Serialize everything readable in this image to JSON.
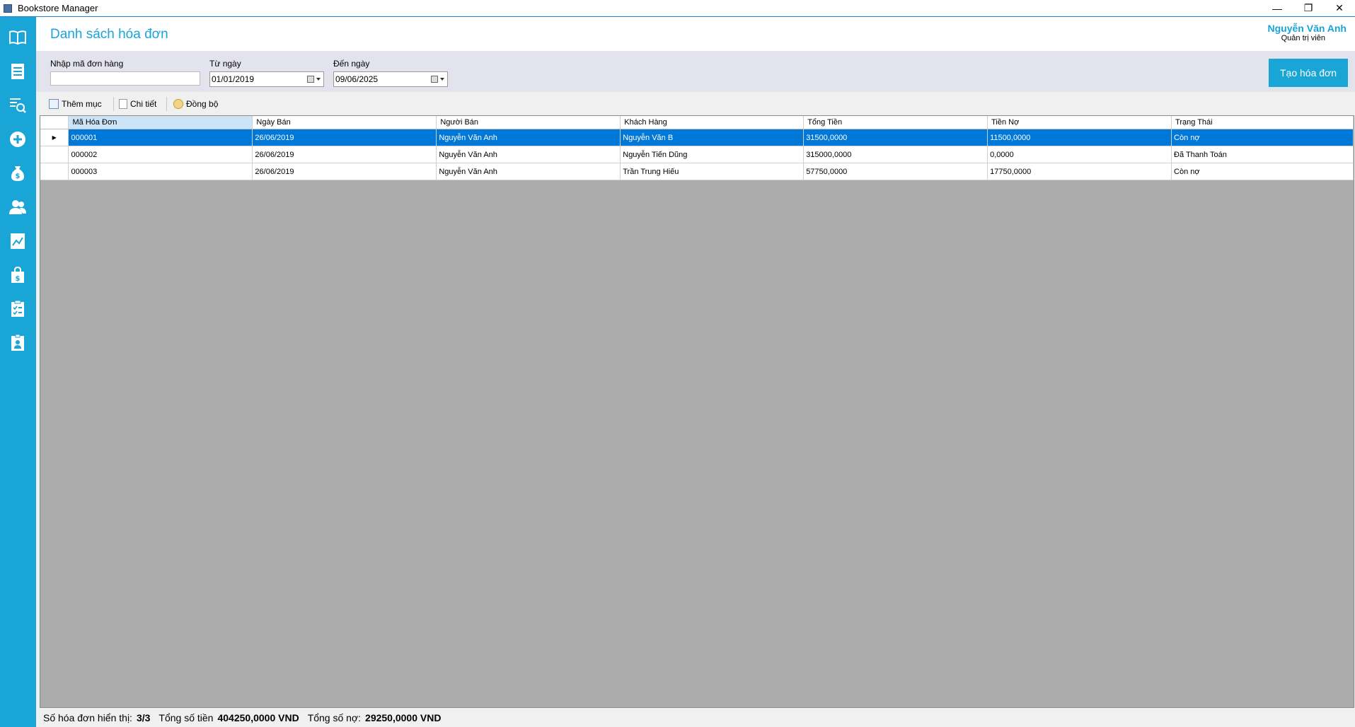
{
  "window": {
    "title": "Bookstore Manager",
    "controls": {
      "minimize": "—",
      "restore": "❐",
      "close": "✕"
    }
  },
  "sidebar": {
    "items": [
      {
        "icon": "book-icon"
      },
      {
        "icon": "invoice-list-icon"
      },
      {
        "icon": "search-document-icon"
      },
      {
        "icon": "add-circle-icon"
      },
      {
        "icon": "money-bag-icon"
      },
      {
        "icon": "users-icon"
      },
      {
        "icon": "chart-icon"
      },
      {
        "icon": "shopping-bag-icon"
      },
      {
        "icon": "clipboard-check-icon"
      },
      {
        "icon": "id-badge-icon"
      }
    ],
    "color": "#19a5d6"
  },
  "header": {
    "title": "Danh sách hóa đơn",
    "user_name": "Nguyễn Văn Anh",
    "user_role": "Quản trị viên"
  },
  "filters": {
    "code_label": "Nhập mã đơn hàng",
    "code_value": "",
    "from_label": "Từ ngày",
    "from_value": "01/01/2019",
    "to_label": "Đến ngày",
    "to_value": "09/06/2025",
    "create_button": "Tạo hóa đơn"
  },
  "toolbar": {
    "add_label": "Thêm mục",
    "detail_label": "Chi tiết",
    "sync_label": "Đồng bộ"
  },
  "table": {
    "columns": [
      "Mã Hóa Đơn",
      "Ngày Bán",
      "Người Bán",
      "Khách Hàng",
      "Tổng Tiền",
      "Tiền Nợ",
      "Trạng Thái"
    ],
    "rows": [
      {
        "selected": true,
        "marker": "▶",
        "cells": [
          "000001",
          "26/06/2019",
          "Nguyễn Văn Anh",
          "Nguyễn Văn B",
          "31500,0000",
          "11500,0000",
          "Còn nợ"
        ]
      },
      {
        "selected": false,
        "marker": "",
        "cells": [
          "000002",
          "26/06/2019",
          "Nguyễn Văn Anh",
          "Nguyễn Tiến Dũng",
          "315000,0000",
          "0,0000",
          "Đã Thanh Toán"
        ]
      },
      {
        "selected": false,
        "marker": "",
        "cells": [
          "000003",
          "26/06/2019",
          "Nguyễn Văn Anh",
          "Trần Trung Hiếu",
          "57750,0000",
          "17750,0000",
          "Còn nợ"
        ]
      }
    ]
  },
  "status": {
    "count_label": "Số hóa đơn hiển thị:",
    "count_value": "3/3",
    "total_label": "Tổng số tiền",
    "total_value": "404250,0000 VND",
    "debt_label": "Tổng số nợ:",
    "debt_value": "29250,0000 VND"
  },
  "colors": {
    "accent": "#19a5d6",
    "selection": "#0078d7",
    "grid_background": "#ababab"
  }
}
